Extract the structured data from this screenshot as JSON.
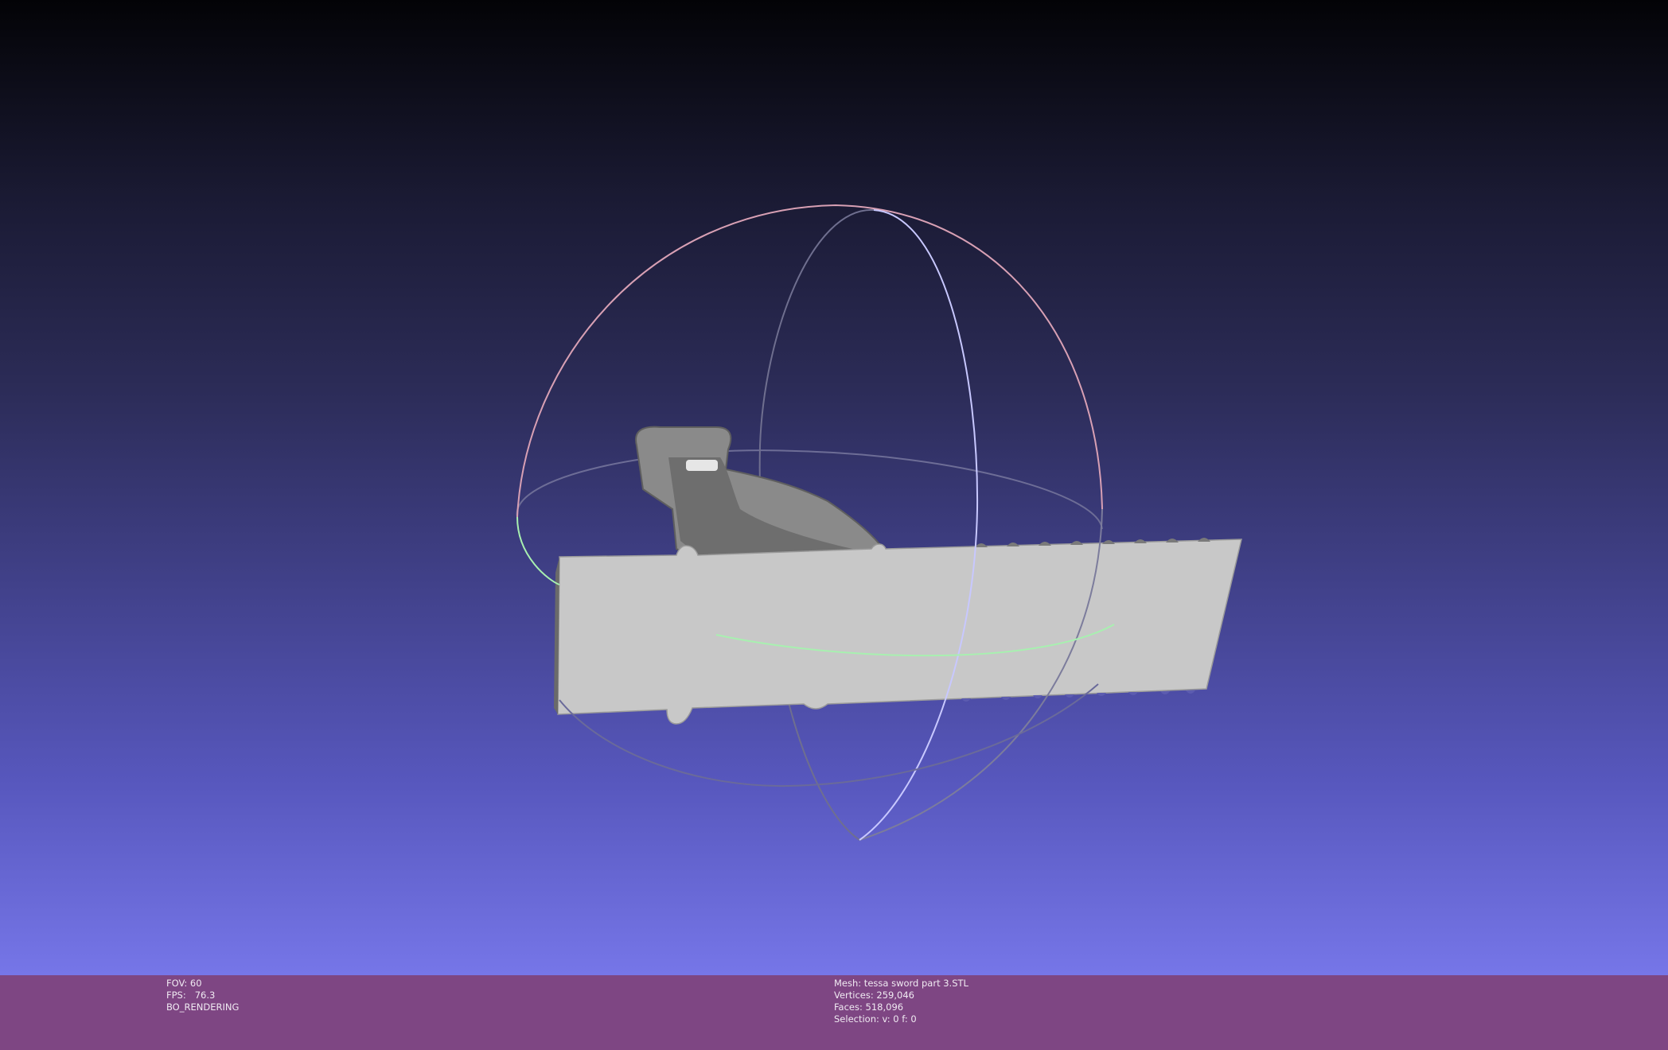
{
  "viewer": {
    "fov": "FOV: 60",
    "fps": "FPS:   76.3",
    "render_mode": "BO_RENDERING"
  },
  "mesh_info": {
    "mesh": "Mesh: tessa sword part 3.STL",
    "vertices": "Vertices: 259,046",
    "faces": "Faces: 518,096",
    "selection": "Selection: v: 0 f: 0"
  },
  "colors": {
    "info_bar": "#7e4683",
    "mesh": "#c8c8c8",
    "trackball_red": "#e0a0b0",
    "trackball_blue": "#c8c8ff",
    "trackball_green": "#a8f0b0"
  },
  "icons": [
    "trackball-gizmo"
  ]
}
